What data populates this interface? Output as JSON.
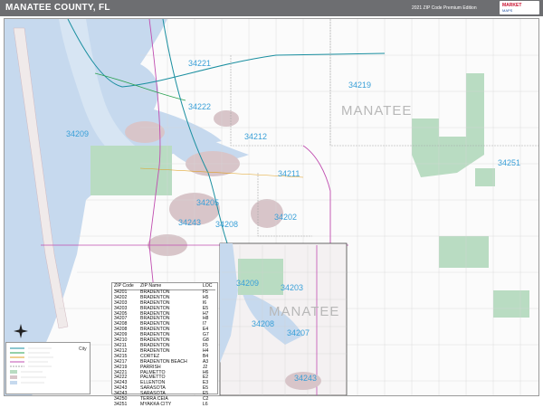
{
  "header": {
    "title": "MANATEE COUNTY, FL",
    "edition": "2021 ZIP Code Premium Edition",
    "logo_line1": "MARKET",
    "logo_line2": "MAPS"
  },
  "map": {
    "county_label": "MANATEE",
    "county_label_inset": "MANATEE",
    "zip_labels": [
      "34221",
      "34219",
      "34222",
      "34209",
      "34212",
      "34211",
      "34251",
      "34205",
      "34243",
      "34208",
      "34202",
      "34209",
      "34203",
      "34208",
      "34207",
      "34243"
    ],
    "colors": {
      "water": "#c6d9ee",
      "land": "#ffffff",
      "parks": "#b9dcc2",
      "urban": "#d8c5c9",
      "zip_text": "#3aa0d8",
      "county_line": "#c04db0",
      "highway": "#1a8fa0"
    }
  },
  "zip_table": {
    "headers": [
      "ZIP Code",
      "ZIP Name",
      "LOC"
    ],
    "rows": [
      [
        "34201",
        "BRADENTON",
        "F5"
      ],
      [
        "34202",
        "BRADENTON",
        "H5"
      ],
      [
        "34203",
        "BRADENTON",
        "I6"
      ],
      [
        "34203",
        "BRADENTON",
        "E5"
      ],
      [
        "34205",
        "BRADENTON",
        "H7"
      ],
      [
        "34207",
        "BRADENTON",
        "H8"
      ],
      [
        "34208",
        "BRADENTON",
        "I7"
      ],
      [
        "34208",
        "BRADENTON",
        "E4"
      ],
      [
        "34209",
        "BRADENTON",
        "G7"
      ],
      [
        "34210",
        "BRADENTON",
        "G8"
      ],
      [
        "34211",
        "BRADENTON",
        "F5"
      ],
      [
        "34212",
        "BRADENTON",
        "H4"
      ],
      [
        "34215",
        "CORTEZ",
        "B4"
      ],
      [
        "34217",
        "BRADENTON BEACH",
        "A3"
      ],
      [
        "34219",
        "PARRISH",
        "J2"
      ],
      [
        "34221",
        "PALMETTO",
        "H6"
      ],
      [
        "34222",
        "PALMETTO",
        "E2"
      ],
      [
        "34243",
        "ELLENTON",
        "E3"
      ],
      [
        "34243",
        "SARASOTA",
        "E5"
      ],
      [
        "34243",
        "SARASOTA",
        "E5"
      ],
      [
        "34250",
        "TERRA CEIA",
        "C2"
      ],
      [
        "34251",
        "MYAKKA CITY",
        "L6"
      ]
    ]
  },
  "legend": {
    "items": [
      "City",
      "",
      "",
      "",
      "",
      "",
      "",
      "",
      "",
      ""
    ]
  }
}
